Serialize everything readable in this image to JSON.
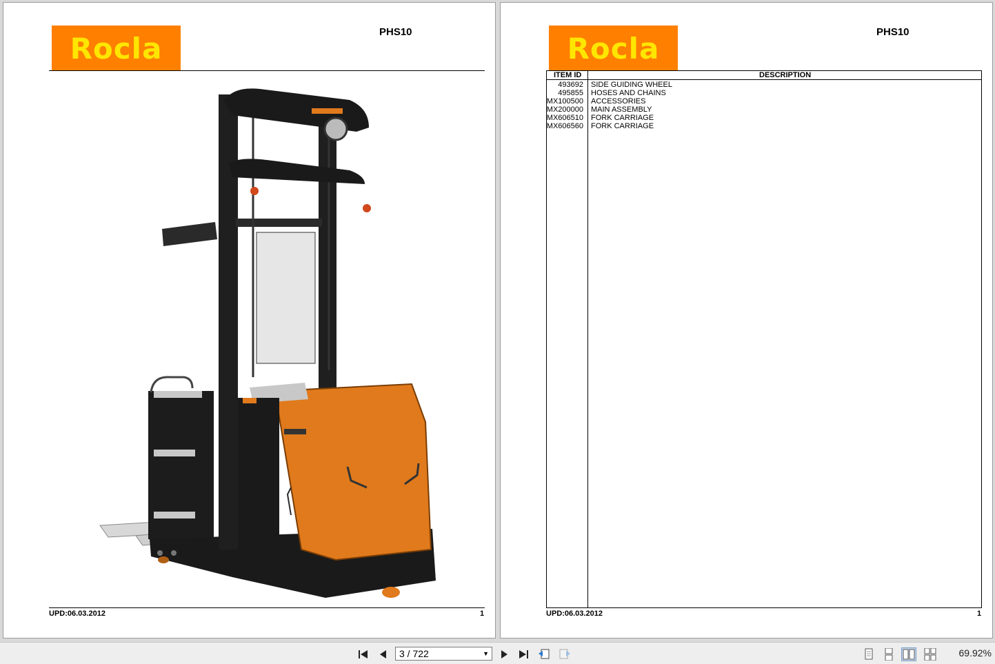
{
  "pages": [
    {
      "logo_text": "Rocla",
      "model": "PHS10",
      "footer_date": "UPD:06.03.2012",
      "footer_page": "1"
    },
    {
      "logo_text": "Rocla",
      "model": "PHS10",
      "footer_date": "UPD:06.03.2012",
      "footer_page": "1",
      "table": {
        "headers": [
          "ITEM ID",
          "DESCRIPTION"
        ],
        "rows": [
          {
            "id": "493692",
            "desc": "SIDE GUIDING WHEEL"
          },
          {
            "id": "495855",
            "desc": "HOSES AND CHAINS"
          },
          {
            "id": "MX100500",
            "desc": "ACCESSORIES"
          },
          {
            "id": "MX200000",
            "desc": "MAIN ASSEMBLY"
          },
          {
            "id": "MX606510",
            "desc": "FORK CARRIAGE"
          },
          {
            "id": "MX606560",
            "desc": "FORK CARRIAGE"
          }
        ]
      }
    }
  ],
  "toolbar": {
    "page_indicator": "3 / 722",
    "zoom": "69.92%",
    "icons": [
      "first-page-icon",
      "prev-page-icon",
      "next-page-icon",
      "last-page-icon",
      "back-view-icon",
      "forward-view-icon",
      "single-page-icon",
      "continuous-icon",
      "facing-icon",
      "continuous-facing-icon"
    ]
  },
  "colors": {
    "brand_orange": "#ff7f00",
    "logo_text_yellow": "#ffe600",
    "truck_orange": "#e07a1c"
  }
}
